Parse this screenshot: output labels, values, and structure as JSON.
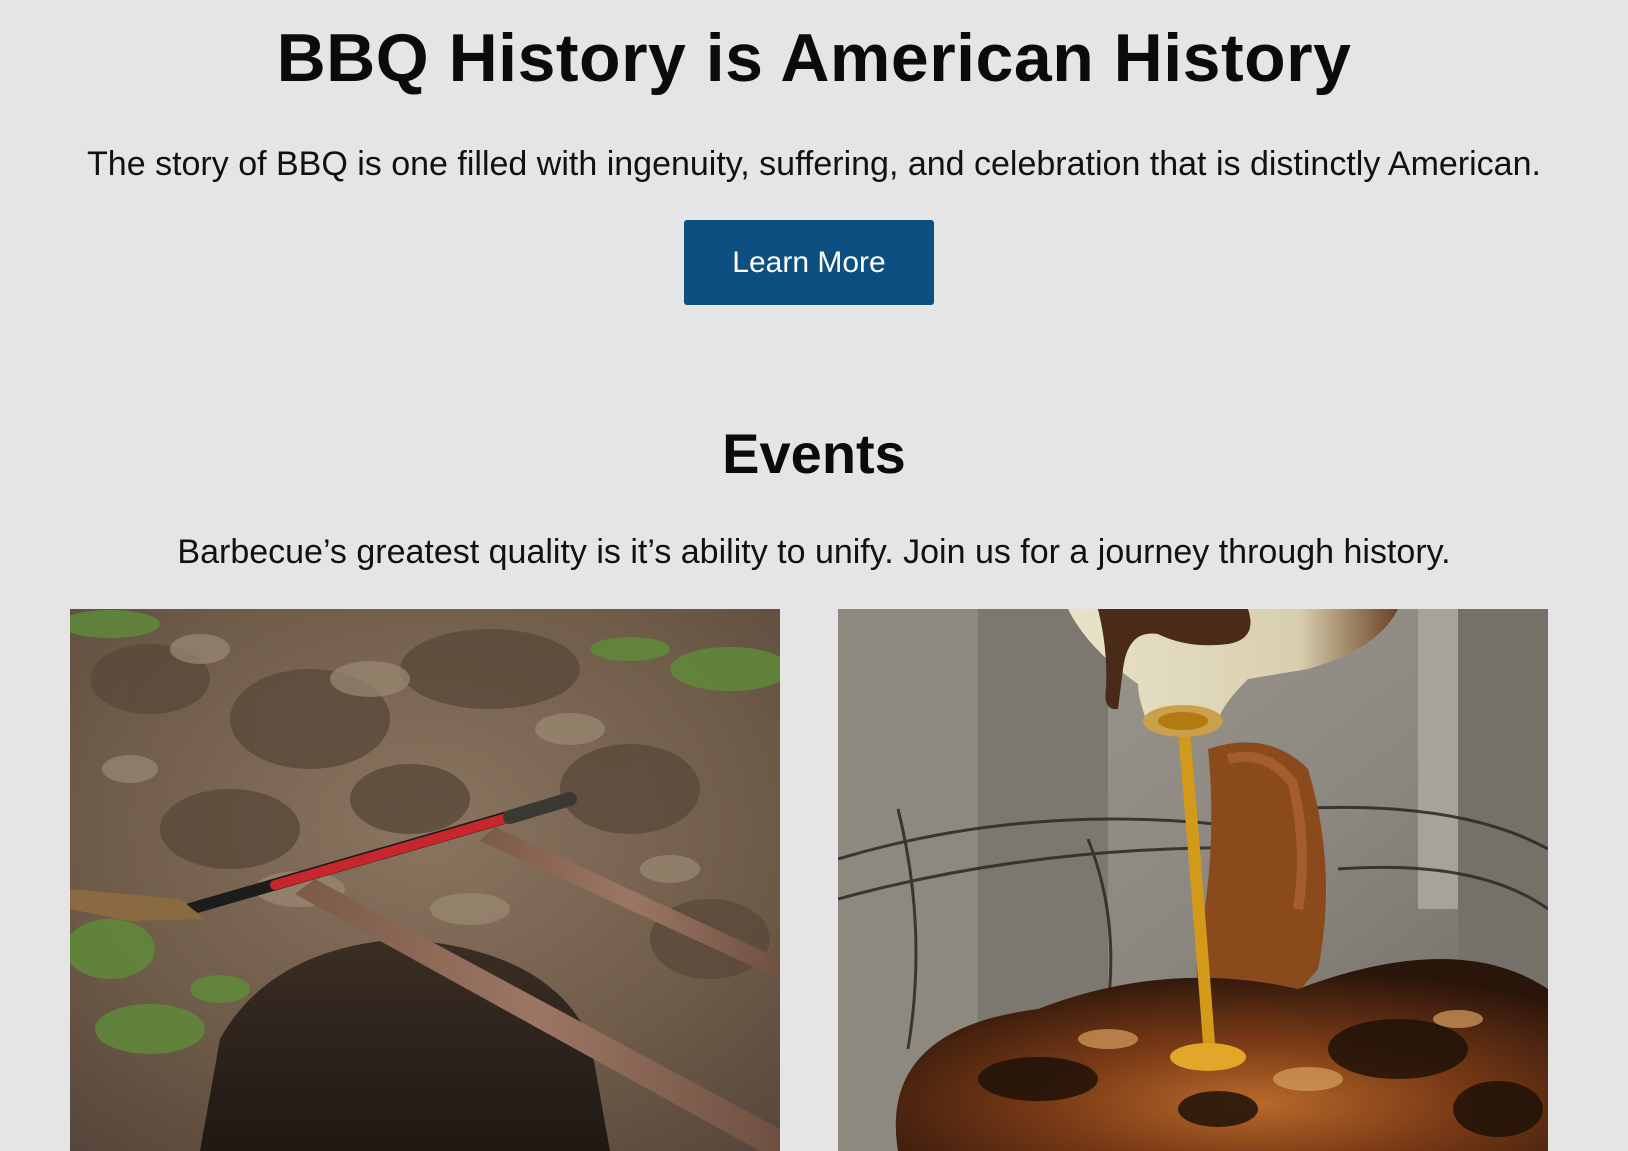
{
  "hero": {
    "title": "BBQ History is American History",
    "subtitle": "The story of BBQ is one filled with ingenuity, suffering, and celebration that is distinctly American.",
    "button_label": "Learn More",
    "button_color": "#0c4f80"
  },
  "events": {
    "title": "Events",
    "subtitle": "Barbecue’s greatest quality is it’s ability to unify. Join us for a journey through history.",
    "cards": [
      {
        "image": "photo of a shovel and metal bars beside a freshly dug pit in the dirt"
      },
      {
        "image": "photo of sauce being poured from a jug onto a whole roasted hog over a cinder block pit"
      }
    ]
  },
  "colors": {
    "background": "#e5e5e5",
    "text": "#111111",
    "accent": "#0c4f80"
  }
}
